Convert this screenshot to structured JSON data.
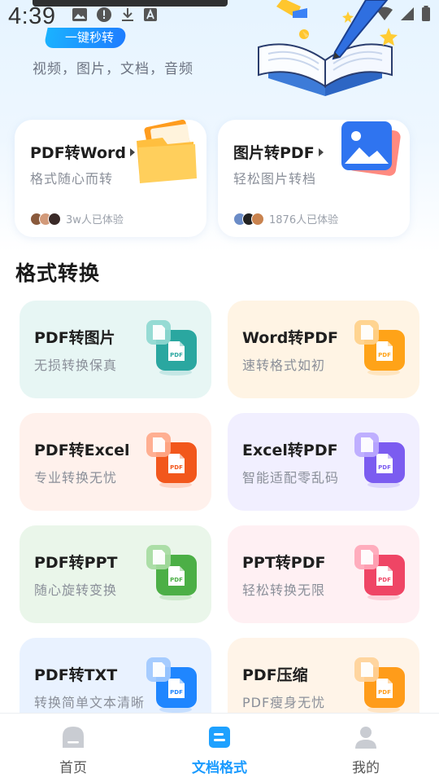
{
  "status_bar": {
    "time": "4:39"
  },
  "hero": {
    "badge": "一键秒转",
    "subtitle": "视频，图片，文档，音频"
  },
  "top_cards": [
    {
      "title": "PDF转Word",
      "subtitle": "格式随心而转",
      "users": "3w人已体验",
      "icon": "folder-icon"
    },
    {
      "title": "图片转PDF",
      "subtitle": "轻松图片转档",
      "users": "1876人已体验",
      "icon": "image-icon"
    }
  ],
  "section": {
    "title": "格式转换"
  },
  "features": [
    {
      "title": "PDF转图片",
      "subtitle": "无损转换保真",
      "bg": "#e7f6f4",
      "color": "#2aa7a0",
      "badge": "#8fd8d0",
      "icon": "pdf-to-image-icon"
    },
    {
      "title": "Word转PDF",
      "subtitle": "速转格式如初",
      "bg": "#fff4e4",
      "color": "#ffa318",
      "badge": "#ffd08a",
      "icon": "word-to-pdf-icon"
    },
    {
      "title": "PDF转Excel",
      "subtitle": "专业转换无忧",
      "bg": "#fff1ec",
      "color": "#f2571c",
      "badge": "#ffa98a",
      "icon": "pdf-to-excel-icon"
    },
    {
      "title": "Excel转PDF",
      "subtitle": "智能适配零乱码",
      "bg": "#f1efff",
      "color": "#7b5cf0",
      "badge": "#bba9ff",
      "icon": "excel-to-pdf-icon"
    },
    {
      "title": "PDF转PPT",
      "subtitle": "随心旋转变换",
      "bg": "#eaf6ea",
      "color": "#4caf46",
      "badge": "#a6dba1",
      "icon": "pdf-to-ppt-icon"
    },
    {
      "title": "PPT转PDF",
      "subtitle": "轻松转换无限",
      "bg": "#fff0f3",
      "color": "#ef4565",
      "badge": "#ffa7b8",
      "icon": "ppt-to-pdf-icon"
    },
    {
      "title": "PDF转TXT",
      "subtitle": "转换简单文本清晰",
      "bg": "#e9f2ff",
      "color": "#1f86ff",
      "badge": "#9fc9ff",
      "icon": "pdf-to-txt-icon"
    },
    {
      "title": "PDF压缩",
      "subtitle": "PDF瘦身无忧",
      "bg": "#fff4e8",
      "color": "#ff9c1a",
      "badge": "#ffd198",
      "icon": "pdf-compress-icon"
    }
  ],
  "nav": [
    {
      "label": "首页",
      "icon": "home-icon",
      "active": false
    },
    {
      "label": "文档格式",
      "icon": "document-format-icon",
      "active": true
    },
    {
      "label": "我的",
      "icon": "profile-icon",
      "active": false
    }
  ]
}
